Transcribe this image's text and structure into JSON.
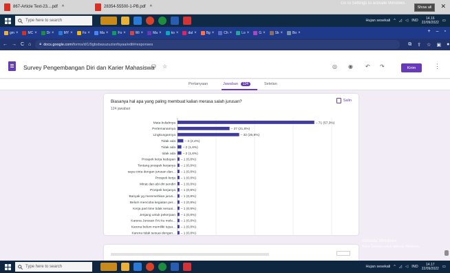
{
  "downloads": {
    "items": [
      {
        "name": "867-Article Text-23....pdf"
      },
      {
        "name": "28354-55500-1-PB.pdf"
      }
    ],
    "show_all": "Show all",
    "watermark": "Go to Settings to activate Windows."
  },
  "taskbar": {
    "search_placeholder": "Type here to search",
    "weather": "Hujan sesekali",
    "lang": "IND",
    "time_top": "14.16",
    "date_top": "22/09/2022",
    "time_bottom": "14.17",
    "date_bottom": "22/09/2022"
  },
  "browser": {
    "tabs": [
      "gm",
      "MC",
      "Dr",
      "MY",
      "Fo",
      "Ma",
      "Fo",
      "Wi",
      "Ma",
      "ko",
      "dal",
      "Bg",
      "Ch",
      "Lo",
      "G",
      "Sk",
      "Bo"
    ],
    "url_domain": "docs.google.com",
    "url_path": "/forms/d/1/9gbsbasuzuzisnfsyaa/edit#responses"
  },
  "form": {
    "title": "Survey Pengembangan Diri dan Karier Mahasiswa",
    "send": "Kirim",
    "nav": {
      "questions": "Pertanyaan",
      "responses": "Jawaban",
      "responses_count": "124",
      "settings": "Setelan"
    }
  },
  "question": {
    "title": "Biasanya hal apa yang paling membuat kalian merasa salah jurusan?",
    "count": "124 jawaban",
    "copy": "Salin"
  },
  "activation": {
    "title": "Aktivasi Windows",
    "sub": "Buka Setelan untuk aktivasi Windows."
  },
  "chart_data": {
    "type": "bar",
    "orientation": "horizontal",
    "categories": [
      "Mata kuliahnya",
      "Pertemanannya",
      "Lingkungannya",
      "Tidak ada",
      "Tidak ada",
      "tidak ada",
      "Prospek kerja kedepan",
      "Tentang prospek kerjanya",
      "saya cinta dengan jurusan dan...",
      "Prospek kerja",
      "Minat dan abi diri sendiri",
      "Prospek kerjanya",
      "Banyak yg meremehkan jurus...",
      "Belum mencoba kegiatan per...",
      "Kerja part time tidak sesuai...",
      "Jenjang untuk pekerjaan",
      "Karena Jurusan PAI itu mele...",
      "Karena belum memiliki tujua...",
      "Karena tidak sesuai dengan..."
    ],
    "values": [
      71,
      27,
      32,
      3,
      2,
      2,
      1,
      1,
      1,
      1,
      1,
      1,
      1,
      1,
      1,
      1,
      1,
      1,
      1
    ],
    "value_labels": [
      "71 (57,3%)",
      "27 (21,8%)",
      "32 (25,8%)",
      "3 (2,4%)",
      "2 (1,6%)",
      "2 (1,6%)",
      "1 (0,8%)",
      "1 (0,8%)",
      "1 (0,8%)",
      "1 (0,8%)",
      "1 (0,8%)",
      "1 (0,8%)",
      "1 (0,8%)",
      "1 (0,8%)",
      "1 (0,8%)",
      "1 (0,8%)",
      "1 (0,8%)",
      "1 (0,8%)",
      "1 (0,8%)"
    ],
    "xlim": [
      0,
      80
    ],
    "xticks": [
      0,
      20,
      40,
      60,
      80
    ],
    "colors": {
      "bar": "#3f3c9e"
    },
    "grid": true
  }
}
